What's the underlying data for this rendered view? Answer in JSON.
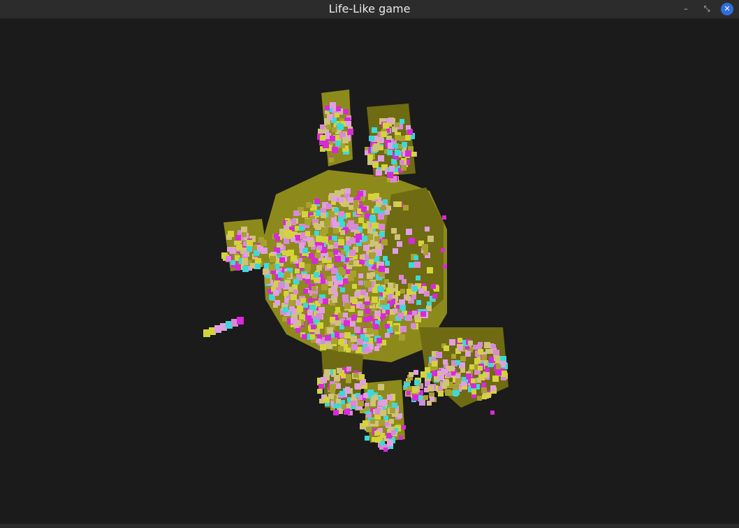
{
  "window": {
    "title": "Life-Like game",
    "controls": {
      "minimize_glyph": "–",
      "restore_glyph": "⤡",
      "close_glyph": "✕"
    }
  },
  "scene": {
    "background_color": "#1b1b1b",
    "cell_colors": [
      "#d4d43a",
      "#a8a12e",
      "#cfc27a",
      "#d88ad8",
      "#e0a0e0",
      "#3ed8d8",
      "#d82ad8"
    ],
    "solid_color": "#8d8a1c",
    "solid_shade": "#6e6b12"
  }
}
